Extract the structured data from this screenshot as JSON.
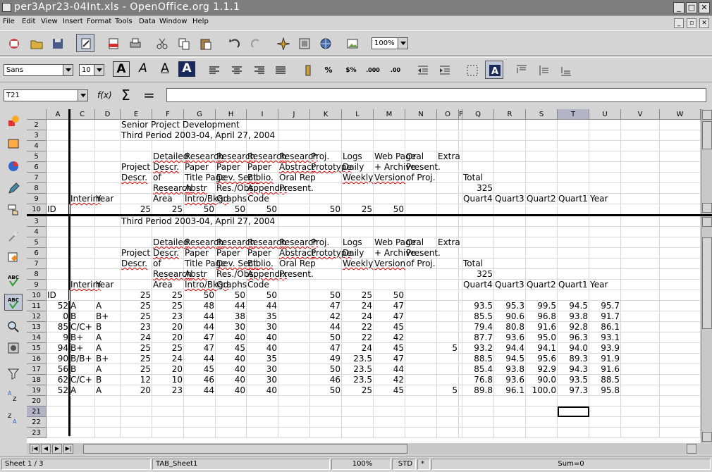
{
  "window": {
    "title": "per3Apr23-04Int.xls - OpenOffice.org 1.1.1"
  },
  "menu": [
    "File",
    "Edit",
    "View",
    "Insert",
    "Format",
    "Tools",
    "Data",
    "Window",
    "Help"
  ],
  "toolbar": {
    "zoom": "100%",
    "font_name": "Sans",
    "font_size": "10"
  },
  "formula": {
    "name_box": "T21",
    "content": ""
  },
  "columns": [
    "A",
    "C",
    "D",
    "E",
    "F",
    "G",
    "H",
    "I",
    "J",
    "K",
    "L",
    "M",
    "N",
    "O",
    "P",
    "Q",
    "R",
    "S",
    "T",
    "U",
    "V",
    "W"
  ],
  "top_pane": {
    "row_numbers": [
      "2",
      "3",
      "4",
      "5",
      "6",
      "7",
      "8",
      "9",
      "10"
    ],
    "rows": {
      "2": {
        "E": "Senior Project Development"
      },
      "3": {
        "E": "Third Period 2003-04, April 27, 2004"
      },
      "4": {},
      "5": {
        "F": "Detailed",
        "G": "Research",
        "H": "Research",
        "I": "Research",
        "J": "Research",
        "K": "Proj.",
        "L": "Logs",
        "M": "Web Page",
        "N": "Oral",
        "O": "Extra"
      },
      "6": {
        "E": "Project",
        "F": "Descr.",
        "G": "Paper",
        "H": "Paper",
        "I": "Paper",
        "J": "Abstract",
        "K": "Prototype",
        "L": "Daily",
        "M": "+ Archive",
        "N": "Present."
      },
      "7": {
        "E": "Descr.",
        "F": "of",
        "G": "Title Page",
        "H": "Dev. Sect.",
        "I": "Biblio.",
        "J": "Oral Rep",
        "L": "Weekly",
        "M": "Version",
        "N": "of Proj.",
        "Q": "Total"
      },
      "8": {
        "F": "Research",
        "G": "Abstr",
        "H": "Res./Obs.",
        "I": "Appendix",
        "J": "Present.",
        "Q": "325"
      },
      "9": {
        "C": "Interim",
        "D": "Year",
        "F": "Area",
        "G": "Intro/Bkgd",
        "H": "Graphs",
        "I": "Code",
        "Q": "Quart4",
        "R": "Quart3",
        "S": "Quart2",
        "T": "Quart1",
        "U": "Year"
      },
      "10": {
        "A": "ID",
        "E": "25",
        "F": "25",
        "G": "50",
        "H": "50",
        "I": "50",
        "K": "50",
        "L": "25",
        "M": "50"
      }
    }
  },
  "bottom_pane": {
    "row_numbers": [
      "3",
      "4",
      "5",
      "6",
      "7",
      "8",
      "9",
      "10",
      "11",
      "12",
      "13",
      "14",
      "15",
      "16",
      "17",
      "18",
      "19",
      "20",
      "21",
      "22",
      "23"
    ],
    "rows": {
      "3": {
        "E": "Third Period 2003-04, April 27, 2004"
      },
      "4": {},
      "5": {
        "F": "Detailed",
        "G": "Research",
        "H": "Research",
        "I": "Research",
        "J": "Research",
        "K": "Proj.",
        "L": "Logs",
        "M": "Web Page",
        "N": "Oral",
        "O": "Extra"
      },
      "6": {
        "E": "Project",
        "F": "Descr.",
        "G": "Paper",
        "H": "Paper",
        "I": "Paper",
        "J": "Abstract",
        "K": "Prototype",
        "L": "Daily",
        "M": "+ Archive",
        "N": "Present."
      },
      "7": {
        "E": "Descr.",
        "F": "of",
        "G": "Title Page",
        "H": "Dev. Sect.",
        "I": "Biblio.",
        "J": "Oral Rep",
        "L": "Weekly",
        "M": "Version",
        "N": "of Proj.",
        "Q": "Total"
      },
      "8": {
        "F": "Research",
        "G": "Abstr",
        "H": "Res./Obs.",
        "I": "Appendix",
        "J": "Present.",
        "Q": "325"
      },
      "9": {
        "C": "Interim",
        "D": "Year",
        "F": "Area",
        "G": "Intro/Bkgd",
        "H": "Graphs",
        "I": "Code",
        "Q": "Quart4",
        "R": "Quart3",
        "S": "Quart2",
        "T": "Quart1",
        "U": "Year"
      },
      "10": {
        "A": "ID",
        "E": "25",
        "F": "25",
        "G": "50",
        "H": "50",
        "I": "50",
        "K": "50",
        "L": "25",
        "M": "50"
      },
      "11": {
        "A": "52",
        "C": "A",
        "D": "A",
        "E": "25",
        "F": "25",
        "G": "48",
        "H": "44",
        "I": "44",
        "K": "47",
        "L": "24",
        "M": "47",
        "Q": "93.5",
        "R": "95.3",
        "S": "99.5",
        "T": "94.5",
        "U": "95.7"
      },
      "12": {
        "A": "0",
        "C": "B",
        "D": "B+",
        "E": "25",
        "F": "23",
        "G": "44",
        "H": "38",
        "I": "35",
        "K": "42",
        "L": "24",
        "M": "47",
        "Q": "85.5",
        "R": "90.6",
        "S": "96.8",
        "T": "93.8",
        "U": "91.7"
      },
      "13": {
        "A": "85",
        "C": "C/C+",
        "D": "B",
        "E": "23",
        "F": "20",
        "G": "44",
        "H": "30",
        "I": "30",
        "K": "44",
        "L": "22",
        "M": "45",
        "Q": "79.4",
        "R": "80.8",
        "S": "91.6",
        "T": "92.8",
        "U": "86.1"
      },
      "14": {
        "A": "9",
        "C": "B+",
        "D": "A",
        "E": "24",
        "F": "20",
        "G": "47",
        "H": "40",
        "I": "40",
        "K": "50",
        "L": "22",
        "M": "42",
        "Q": "87.7",
        "R": "93.6",
        "S": "95.0",
        "T": "96.3",
        "U": "93.1"
      },
      "15": {
        "A": "94",
        "C": "B+",
        "D": "A",
        "E": "25",
        "F": "25",
        "G": "47",
        "H": "45",
        "I": "40",
        "K": "47",
        "L": "24",
        "M": "45",
        "O": "5",
        "Q": "93.2",
        "R": "94.4",
        "S": "94.1",
        "T": "94.0",
        "U": "93.9"
      },
      "16": {
        "A": "90",
        "C": "B/B+",
        "D": "B+",
        "E": "25",
        "F": "24",
        "G": "44",
        "H": "40",
        "I": "35",
        "K": "49",
        "L": "23.5",
        "M": "47",
        "Q": "88.5",
        "R": "94.5",
        "S": "95.6",
        "T": "89.3",
        "U": "91.9"
      },
      "17": {
        "A": "56",
        "C": "B",
        "D": "A",
        "E": "25",
        "F": "20",
        "G": "45",
        "H": "40",
        "I": "30",
        "K": "50",
        "L": "23.5",
        "M": "44",
        "Q": "85.4",
        "R": "93.8",
        "S": "92.9",
        "T": "94.3",
        "U": "91.6"
      },
      "18": {
        "A": "62",
        "C": "C/C+",
        "D": "B",
        "E": "12",
        "F": "10",
        "G": "46",
        "H": "40",
        "I": "30",
        "K": "46",
        "L": "23.5",
        "M": "42",
        "Q": "76.8",
        "R": "93.6",
        "S": "90.0",
        "T": "93.5",
        "U": "88.5"
      },
      "19": {
        "A": "52",
        "C": "A",
        "D": "A",
        "E": "20",
        "F": "23",
        "G": "44",
        "H": "40",
        "I": "40",
        "K": "50",
        "L": "25",
        "M": "45",
        "O": "5",
        "Q": "89.8",
        "R": "96.1",
        "S": "100.0",
        "T": "97.3",
        "U": "95.8"
      },
      "20": {},
      "21": {},
      "22": {},
      "23": {}
    }
  },
  "status": {
    "sheet": "Sheet 1 / 3",
    "page_style": "TAB_Sheet1",
    "zoom": "100%",
    "mode": "STD",
    "modified": "*",
    "sum": "Sum=0"
  }
}
